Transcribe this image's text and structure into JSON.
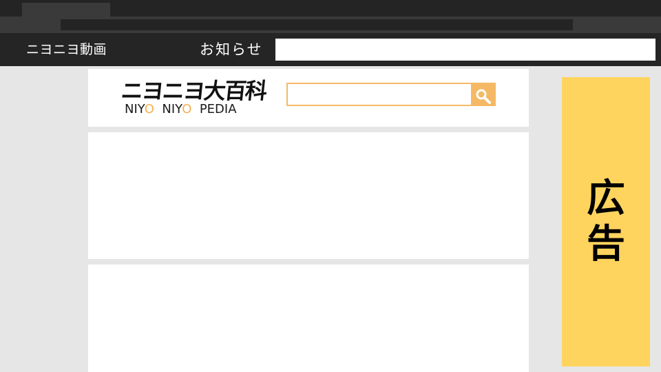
{
  "site_header": {
    "site_name": "ニヨニヨ動画",
    "notice_label": "お知らせ"
  },
  "logo": {
    "title": "ニヨニヨ大百科",
    "subtitle_parts": [
      "NIY",
      "O",
      "  NIY",
      "O",
      "  PEDIA"
    ]
  },
  "search": {
    "placeholder": "",
    "value": "",
    "icon": "magnifier-icon"
  },
  "ad": {
    "line1": "広",
    "line2": "告"
  },
  "colors": {
    "header_bg": "#252525",
    "accent": "#f5b965",
    "ad_bg": "#ffd45e",
    "page_bg": "#e6e6e6"
  }
}
